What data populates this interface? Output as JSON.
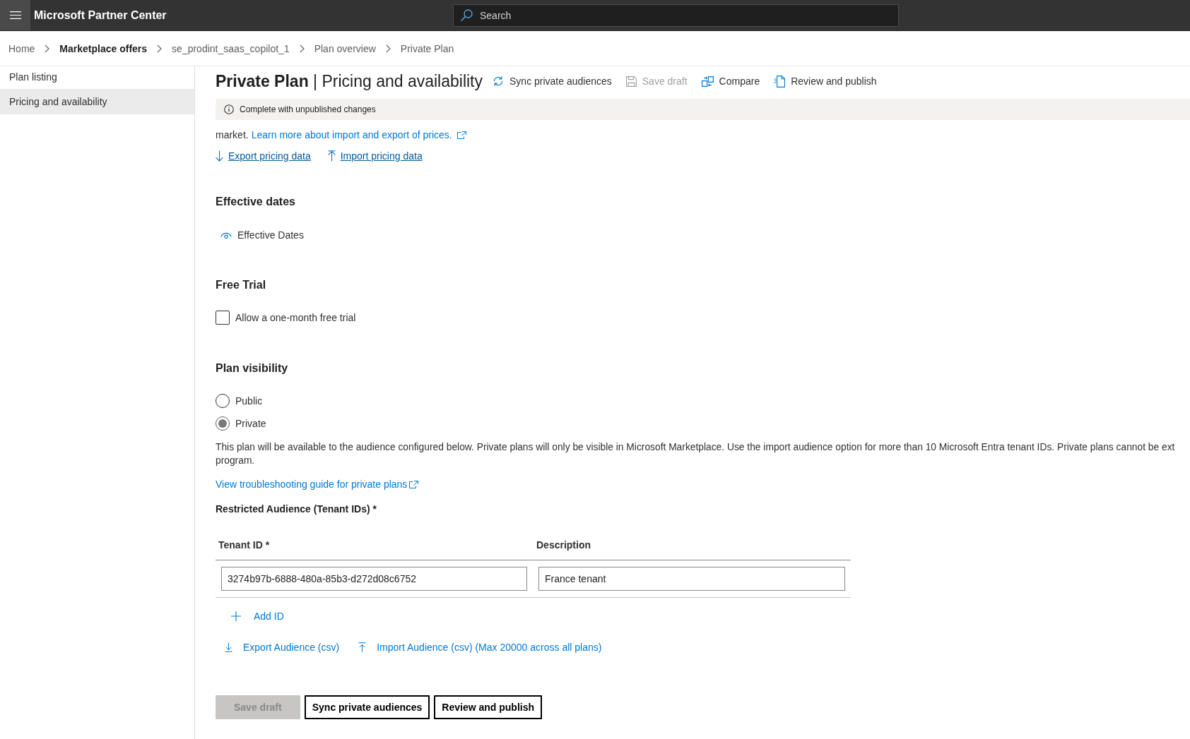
{
  "top_bar": {
    "title": "Microsoft Partner Center",
    "search": {
      "placeholder": "Search"
    }
  },
  "breadcrumb": [
    {
      "label": "Home",
      "highlighted": false
    },
    {
      "label": "Marketplace offers",
      "highlighted": true
    },
    {
      "label": "se_prodint_saas_copilot_1",
      "highlighted": false
    },
    {
      "label": "Plan overview",
      "highlighted": false
    },
    {
      "label": "Private Plan",
      "highlighted": false
    }
  ],
  "sidebar": {
    "items": [
      {
        "label": "Plan listing",
        "selected": false
      },
      {
        "label": "Pricing and availability",
        "selected": true
      }
    ]
  },
  "header": {
    "title": "**Private Plan** | Pricing and availability",
    "toolbar": [
      {
        "kind": "sync",
        "label": "Sync private audiences",
        "disabled": false
      },
      {
        "kind": "save",
        "label": "Save draft",
        "disabled": true
      },
      {
        "kind": "compare",
        "label": "Compare",
        "disabled": false
      },
      {
        "kind": "publish",
        "label": "Review and publish",
        "disabled": false
      }
    ]
  },
  "status_bar": {
    "text": "Complete with unpublished changes"
  },
  "pricing": {
    "text": "market.",
    "link": "Learn more about import and export of prices.",
    "actions": [
      {
        "kind": "export",
        "label": "Export pricing data"
      },
      {
        "kind": "import",
        "label": "Import pricing data"
      }
    ]
  },
  "effective_dates": {
    "heading": "Effective dates",
    "toggle": "Effective Dates"
  },
  "free_trial": {
    "heading": "Free Trial",
    "checkbox": {
      "label": "Allow a one-month free trial",
      "checked": false
    }
  },
  "plan_visibility": {
    "heading": "Plan visibility",
    "options": [
      {
        "label": "Public",
        "selected": false
      },
      {
        "label": "Private",
        "selected": true
      }
    ],
    "description_lines": [
      "This plan will be available to the audience configured below. Private plans will only be visible in Microsoft Marketplace. Use the import audience option for more than 10 Microsoft Entra tenant IDs. Private plans cannot be ext",
      "program."
    ],
    "guide_link": "View troubleshooting guide for private plans"
  },
  "audience": {
    "heading": "Restricted Audience (Tenant IDs) *",
    "columns": [
      "Tenant ID *",
      "Description"
    ],
    "rows": [
      {
        "tenant_id": "3274b97b-6888-480a-85b3-d272d08c6752",
        "description": "France tenant"
      }
    ],
    "add_link": "Add ID",
    "actions": [
      {
        "kind": "export",
        "label": "Export Audience (csv)"
      },
      {
        "kind": "import",
        "label": "Import Audience (csv) (Max 20000 across all plans)"
      }
    ]
  },
  "footer_buttons": [
    {
      "label": "Save draft",
      "disabled": true
    },
    {
      "label": "Sync private audiences",
      "disabled": false
    },
    {
      "label": "Review and publish",
      "disabled": false
    }
  ]
}
